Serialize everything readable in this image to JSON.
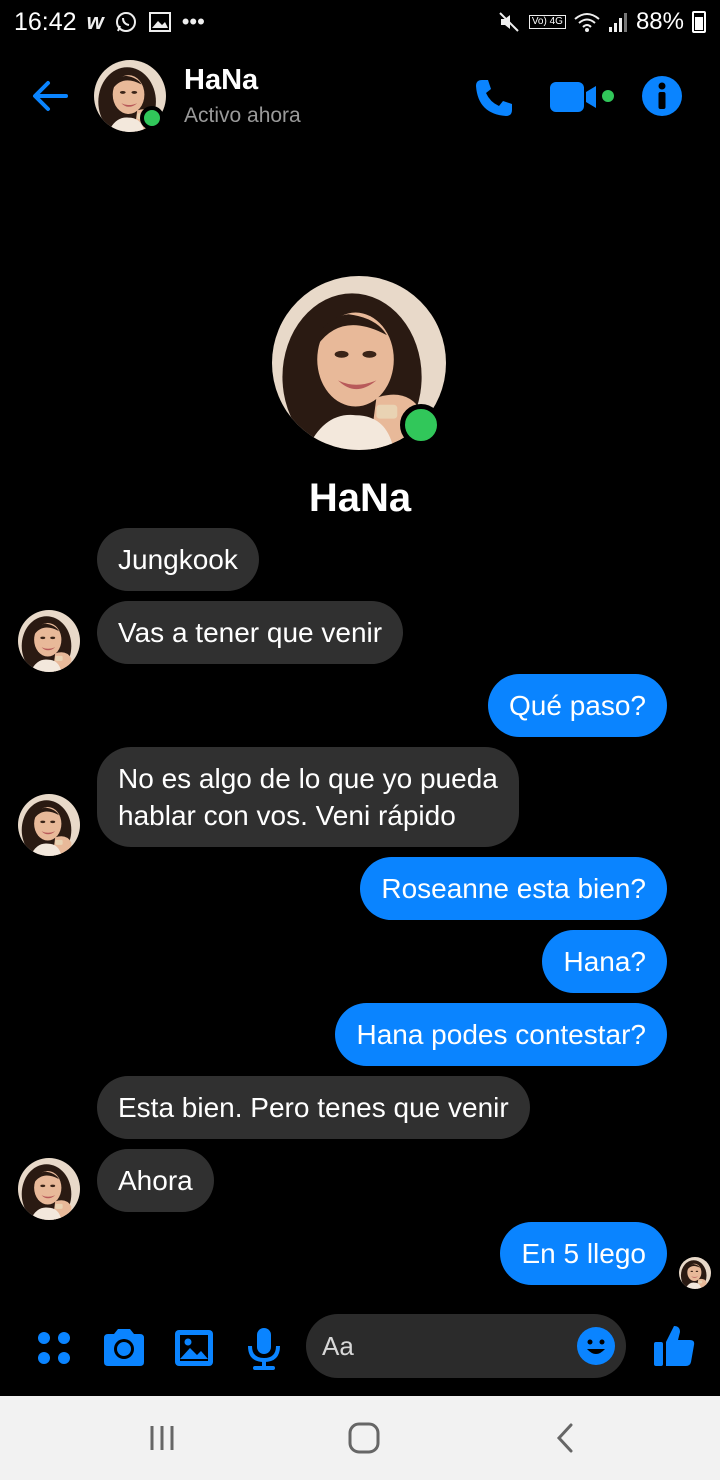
{
  "status_bar": {
    "time": "16:42",
    "left_icons": [
      "w-app-icon",
      "whatsapp-icon",
      "gallery-icon",
      "more-dots-icon"
    ],
    "right_icons": [
      "mute-icon",
      "volte-4g-icon",
      "wifi-icon",
      "signal-icon",
      "battery-icon"
    ],
    "network_label": "Vo) 4G",
    "battery": "88%"
  },
  "header": {
    "name": "HaNa",
    "status": "Activo ahora",
    "icons": [
      "back-arrow-icon",
      "phone-icon",
      "video-camera-icon",
      "info-icon"
    ]
  },
  "profile": {
    "name": "HaNa"
  },
  "messages": [
    {
      "from": "them",
      "text": "Jungkook"
    },
    {
      "from": "them",
      "text": "Vas a tener que venir"
    },
    {
      "from": "me",
      "text": "Qué paso?"
    },
    {
      "from": "them",
      "text": "No es algo de lo que yo pueda"
    },
    {
      "from": "them",
      "text": "hablar con vos. Veni rápido"
    },
    {
      "from": "me",
      "text": "Roseanne esta bien?"
    },
    {
      "from": "me",
      "text": "Hana?"
    },
    {
      "from": "me",
      "text": "Hana podes contestar?"
    },
    {
      "from": "them",
      "text": "Esta bien. Pero tenes que venir"
    },
    {
      "from": "them",
      "text": "Ahora"
    },
    {
      "from": "me",
      "text": "En 5 llego"
    }
  ],
  "composer": {
    "placeholder": "Aa",
    "icons": [
      "apps-grid-icon",
      "camera-icon",
      "image-icon",
      "microphone-icon",
      "emoji-icon",
      "thumbs-up-icon"
    ]
  },
  "colors": {
    "accent": "#0a84ff",
    "incoming_bubble": "#303030",
    "online": "#31c75a",
    "background": "#000000"
  }
}
